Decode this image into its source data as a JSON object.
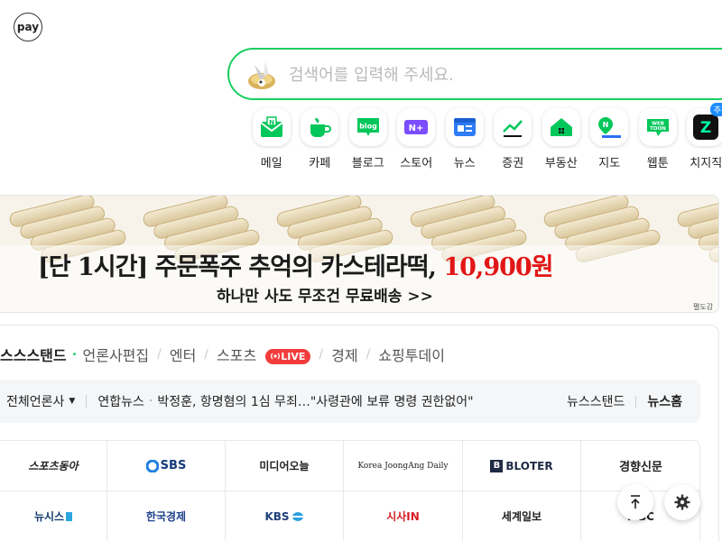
{
  "pay": {
    "label": "pay"
  },
  "search": {
    "placeholder": "검색어를 입력해 주세요."
  },
  "shortcuts": [
    {
      "label": "메일",
      "icon": "mail-icon"
    },
    {
      "label": "카페",
      "icon": "cafe-icon"
    },
    {
      "label": "블로그",
      "icon": "blog-icon",
      "icon_text": "blog"
    },
    {
      "label": "스토어",
      "icon": "store-icon",
      "icon_text": "N+"
    },
    {
      "label": "뉴스",
      "icon": "news-icon"
    },
    {
      "label": "증권",
      "icon": "stock-icon"
    },
    {
      "label": "부동산",
      "icon": "realestate-icon"
    },
    {
      "label": "지도",
      "icon": "map-icon",
      "icon_text": "N"
    },
    {
      "label": "웹툰",
      "icon": "webtoon-icon",
      "icon_text": "WEB TOON"
    },
    {
      "label": "치지직",
      "icon": "chzzk-icon",
      "icon_text": "Z",
      "badge": "추천"
    }
  ],
  "banner": {
    "main_text": "[단 1시간] 주문폭주 추억의 카스테라떡, ",
    "price": "10,900원",
    "sub_text": "하나만 사도 무조건 무료배송 >>",
    "ad_label": "펼도감"
  },
  "news_tabs": {
    "items": [
      "스스스탠드",
      "언론사편집",
      "엔터",
      "스포츠",
      "경제",
      "쇼핑투데이"
    ],
    "live_label": "LIVE"
  },
  "news_bar": {
    "press_filter": "전체언론사",
    "source": "연합뉴스",
    "headline": "박정훈, 항명혐의 1심 무죄…\"사령관에 보류 명령 권한없어\"",
    "link_newsstand": "뉴스스탠드",
    "link_newshome": "뉴스홈"
  },
  "press": [
    {
      "name": "스포츠동아",
      "color": "#111111"
    },
    {
      "name": "SBS",
      "color": "#163b7b"
    },
    {
      "name": "미디어오늘",
      "color": "#111111"
    },
    {
      "name": "Korea JoongAng Daily",
      "color": "#222222"
    },
    {
      "name": "BLOTER",
      "color": "#1f2a44"
    },
    {
      "name": "경향신문",
      "color": "#111111"
    },
    {
      "name": "뉴시스",
      "color": "#123b6e"
    },
    {
      "name": "한국경제",
      "color": "#1d3f8a"
    },
    {
      "name": "KBS",
      "color": "#1f3f7a"
    },
    {
      "name": "시사IN",
      "color": "#d61f26"
    },
    {
      "name": "세계일보",
      "color": "#111111"
    },
    {
      "name": "MBC",
      "color": "#222222"
    }
  ],
  "colors": {
    "brand_green": "#19ce60",
    "live_red": "#f23c3c",
    "price_red": "#e21616"
  }
}
